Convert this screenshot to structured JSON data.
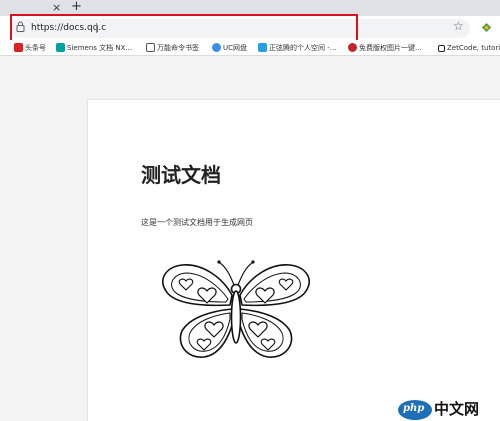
{
  "browser": {
    "tab_close": "×",
    "new_tab": "+",
    "address": {
      "url": "https://docs.qq.c",
      "star": "☆"
    },
    "bookmarks": [
      {
        "label": "头条号",
        "icon": "toutiao-icon",
        "color": "#e02020"
      },
      {
        "label": "Siemens 文档 NX...",
        "icon": "siemens-icon",
        "color": "#00a3a3"
      },
      {
        "label": "万能命令书签",
        "icon": "page-icon",
        "color": "#555555"
      },
      {
        "label": "UC网盘",
        "icon": "cloud-icon",
        "color": "#3a8ee6"
      },
      {
        "label": "正弦腾的个人空间 -...",
        "icon": "bilibili-icon",
        "color": "#23a0e6"
      },
      {
        "label": "免费版权图片一键...",
        "icon": "pixabay-icon",
        "color": "#c0262d"
      },
      {
        "label": "ZetCode, tutori",
        "icon": "square-icon",
        "color": "#222222"
      }
    ]
  },
  "document": {
    "title": "测试文档",
    "paragraph": "这是一个测试文档用于生成网页"
  },
  "watermark": {
    "logo": "php",
    "text": "中文网"
  },
  "colors": {
    "highlight_box": "#d7141c",
    "watermark_blue": "#1e6fb8"
  }
}
